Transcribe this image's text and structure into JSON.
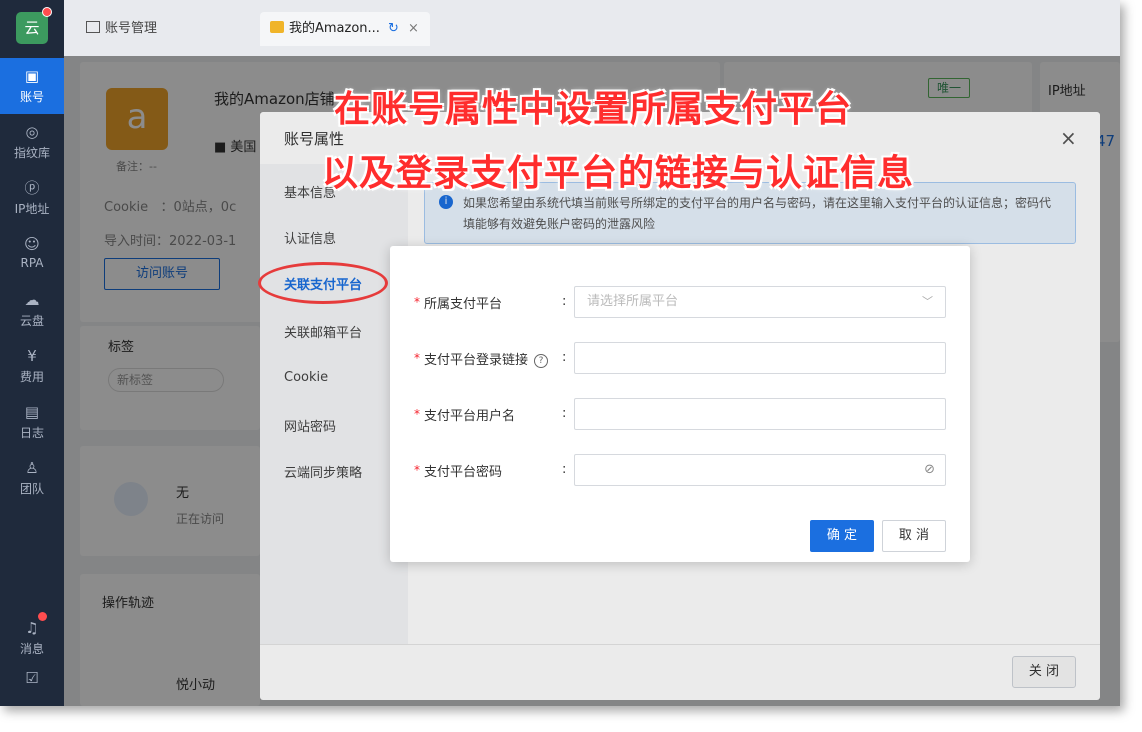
{
  "app": {
    "logo_char": "云"
  },
  "sidebar": {
    "items": [
      {
        "label": "账号",
        "icon": "id-card-icon",
        "glyph": "▣"
      },
      {
        "label": "指纹库",
        "icon": "fingerprint-icon",
        "glyph": "◎"
      },
      {
        "label": "IP地址",
        "icon": "ip-icon",
        "glyph": "ⓟ"
      },
      {
        "label": "RPA",
        "icon": "robot-icon",
        "glyph": "☺"
      },
      {
        "label": "云盘",
        "icon": "cloud-disk-icon",
        "glyph": "☁"
      },
      {
        "label": "费用",
        "icon": "yen-icon",
        "glyph": "¥"
      },
      {
        "label": "日志",
        "icon": "log-icon",
        "glyph": "▤"
      },
      {
        "label": "团队",
        "icon": "team-icon",
        "glyph": "♙"
      }
    ],
    "bottom": [
      {
        "label": "消息",
        "icon": "bell-icon",
        "glyph": "♫"
      },
      {
        "label": "",
        "icon": "clipboard-icon",
        "glyph": "☑"
      }
    ]
  },
  "tabs": [
    {
      "label": "账号管理"
    },
    {
      "label": "我的Amazon..."
    }
  ],
  "account": {
    "name": "我的Amazon店铺",
    "region": "美国",
    "note": "备注：--",
    "cookie_label": "Cookie",
    "cookie_value": "：0站点，0c",
    "import_label": "导入时间：",
    "import_value": "2022-03-1",
    "visit_button": "访问账号",
    "tag_title": "标签",
    "new_tag": "新标签",
    "visitor_name": "无",
    "visitor_status": "正在访问",
    "track_title": "操作轨迹",
    "track_user": "悦小动"
  },
  "right_panel": {
    "unique_badge": "唯一",
    "ip_title": "IP地址",
    "ip_fragment": "47"
  },
  "attr_modal": {
    "title": "账号属性",
    "menu": [
      "基本信息",
      "认证信息",
      "关联支付平台",
      "关联邮箱平台",
      "Cookie",
      "网站密码",
      "云端同步策略"
    ],
    "selected_index": 2,
    "info": "如果您希望由系统代填当前账号所绑定的支付平台的用户名与密码，请在这里输入支付平台的认证信息；密码代填能够有效避免账户密码的泄露风险",
    "close_button": "关 闭"
  },
  "dialog": {
    "fields": [
      {
        "label": "所属支付平台",
        "placeholder": "请选择所属平台",
        "type": "select"
      },
      {
        "label": "支付平台登录链接",
        "placeholder": "",
        "type": "text",
        "help": true
      },
      {
        "label": "支付平台用户名",
        "placeholder": "",
        "type": "text"
      },
      {
        "label": "支付平台密码",
        "placeholder": "",
        "type": "password"
      }
    ],
    "ok_button": "确 定",
    "cancel_button": "取 消"
  },
  "annotations": {
    "line1": "在账号属性中设置所属支付平台",
    "line2": "以及登录支付平台的链接与认证信息"
  },
  "colors": {
    "primary": "#1b6fe0",
    "sidebar": "#1f2a3c",
    "annotation": "#ff2d2d"
  }
}
